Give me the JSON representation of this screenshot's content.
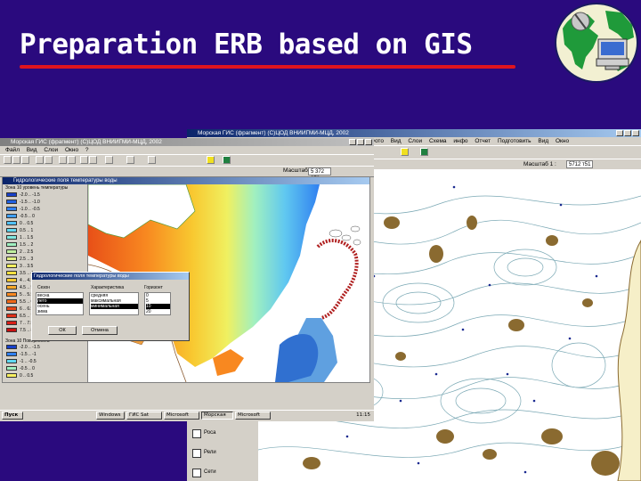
{
  "slide": {
    "title": "Preparation ERB based on GIS",
    "accent_color": "#e0141e",
    "background_color": "#2a0a7e"
  },
  "logo": {
    "icon": "globe-computer-icon"
  },
  "back_window": {
    "title": "Морская ГИС (фрагмент)    (С)ЦОД ВНИИГМИ-МЦД, 2002",
    "menu": [
      "Фото",
      "Вид",
      "Слои",
      "Схема",
      "инфо",
      "Отчет",
      "Подготовить",
      "Вид",
      "Окно"
    ],
    "scale_label": "Масштаб 1 :",
    "scale_value": "5712 т51",
    "layers": [
      "Роса",
      "Рели",
      "Сети"
    ]
  },
  "front_window": {
    "title": "Морская ГИС (фрагмент)  (С)ЦОД ВНИИГМИ-МЦД, 2002",
    "menu": [
      "Файл",
      "Вид",
      "Слои",
      "Окно",
      "?"
    ],
    "scale_label": "Масштаб 1 :",
    "scale_value": "5 372 378",
    "legend_title": "Гидрологические поля температуры воды",
    "legend_heading": "Зона 10 уровень температуры",
    "legend_items": [
      "-2.0 .. -1.5",
      "-1.5 .. -1.0",
      "-1.0 .. -0.5",
      "-0.5 .. 0",
      "0 .. 0.5",
      "0.5 .. 1",
      "1 .. 1.5",
      "1.5 .. 2",
      "2 .. 2.5",
      "2.5 .. 3",
      "3 .. 3.5",
      "3.5 .. 4",
      "4 .. 4.5",
      "4.5 .. 5",
      "5 .. 5.5",
      "5.5 .. 6",
      "6 .. 6.5",
      "6.5 .. 7",
      "7 .. 7.5",
      "7.5 .. 8"
    ],
    "legend_colors": [
      "#1840c8",
      "#2060e0",
      "#3080f0",
      "#40a0f8",
      "#50c0f8",
      "#60d8f0",
      "#80e8e0",
      "#a0f0c0",
      "#c0f0a0",
      "#e0f080",
      "#f8f060",
      "#f8e040",
      "#f8c830",
      "#f8a828",
      "#f88820",
      "#f06818",
      "#e84818",
      "#e03018",
      "#d82018",
      "#c81010"
    ],
    "legend2_heading": "Зона 10 Поверхность",
    "legend2_items": [
      "-2.0 .. -1.5",
      "-1.5 .. -1",
      "-1 .. -0.5",
      "-0.5 .. 0",
      "0 .. 0.5"
    ],
    "legend2_colors": [
      "#1840c8",
      "#3080f0",
      "#60d8f0",
      "#a0f0c0",
      "#f8f060"
    ]
  },
  "dialog": {
    "title": "Гидрологические поля температуры воды",
    "col1_label": "Сезон",
    "col2_label": "Характеристика",
    "col3_label": "Горизонт",
    "col1_items": [
      "весна",
      "лето",
      "осень",
      "зима"
    ],
    "col2_items": [
      "средняя",
      "максимальная",
      "минимальная"
    ],
    "col3_items": [
      "0",
      "5",
      "10",
      "20"
    ],
    "ok_label": "ОК",
    "cancel_label": "Отмена"
  },
  "taskbar": {
    "items": [
      "Пуск",
      "Windows",
      "ГИС Sat",
      "Microsoft",
      "Морская",
      "Microsoft"
    ],
    "clock": "11:15"
  }
}
